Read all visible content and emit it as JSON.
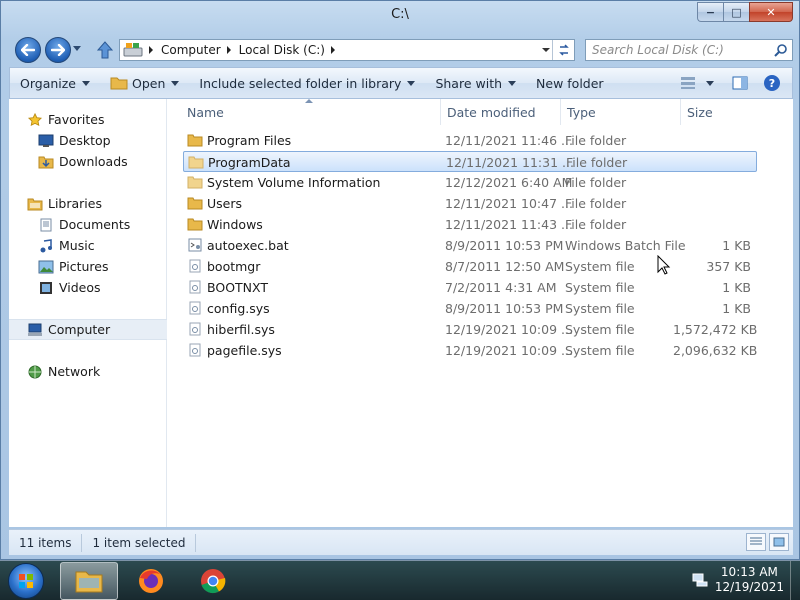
{
  "window": {
    "title": "C:\\",
    "caption": {
      "minimize": "−",
      "maximize": "□",
      "close": "✕"
    }
  },
  "address": {
    "crumbs": [
      "Computer",
      "Local Disk (C:)"
    ],
    "search_placeholder": "Search Local Disk (C:)"
  },
  "commands": {
    "organize": "Organize",
    "open": "Open",
    "include": "Include selected folder in library",
    "share": "Share with",
    "new_folder": "New folder",
    "help": "?"
  },
  "nav": {
    "favorites": "Favorites",
    "desktop": "Desktop",
    "downloads": "Downloads",
    "libraries": "Libraries",
    "documents": "Documents",
    "music": "Music",
    "pictures": "Pictures",
    "videos": "Videos",
    "computer": "Computer",
    "network": "Network"
  },
  "columns": {
    "name": "Name",
    "date": "Date modified",
    "type": "Type",
    "size": "Size"
  },
  "files": [
    {
      "name": "Program Files",
      "date": "12/11/2021 11:46 ...",
      "type": "File folder",
      "size": "",
      "icon": "folder"
    },
    {
      "name": "ProgramData",
      "date": "12/11/2021 11:31 ...",
      "type": "File folder",
      "size": "",
      "icon": "folder-faded"
    },
    {
      "name": "System Volume Information",
      "date": "12/12/2021 6:40 AM",
      "type": "File folder",
      "size": "",
      "icon": "folder-faded"
    },
    {
      "name": "Users",
      "date": "12/11/2021 10:47 ...",
      "type": "File folder",
      "size": "",
      "icon": "folder"
    },
    {
      "name": "Windows",
      "date": "12/11/2021 11:43 ...",
      "type": "File folder",
      "size": "",
      "icon": "folder"
    },
    {
      "name": "autoexec.bat",
      "date": "8/9/2011 10:53 PM",
      "type": "Windows Batch File",
      "size": "1 KB",
      "icon": "batch"
    },
    {
      "name": "bootmgr",
      "date": "8/7/2011 12:50 AM",
      "type": "System file",
      "size": "357 KB",
      "icon": "sysfile"
    },
    {
      "name": "BOOTNXT",
      "date": "7/2/2011 4:31 AM",
      "type": "System file",
      "size": "1 KB",
      "icon": "sysfile"
    },
    {
      "name": "config.sys",
      "date": "8/9/2011 10:53 PM",
      "type": "System file",
      "size": "1 KB",
      "icon": "sysfile"
    },
    {
      "name": "hiberfil.sys",
      "date": "12/19/2021 10:09 ...",
      "type": "System file",
      "size": "1,572,472 KB",
      "icon": "sysfile"
    },
    {
      "name": "pagefile.sys",
      "date": "12/19/2021 10:09 ...",
      "type": "System file",
      "size": "2,096,632 KB",
      "icon": "sysfile"
    }
  ],
  "status": {
    "count": "11 items",
    "selected": "1 item selected"
  },
  "taskbar": {
    "time": "10:13 AM",
    "date": "12/19/2021"
  },
  "colors": {
    "selection_border": "#84acdd",
    "selection_fill": "#cce2fb",
    "folder": "#e8b84a"
  }
}
